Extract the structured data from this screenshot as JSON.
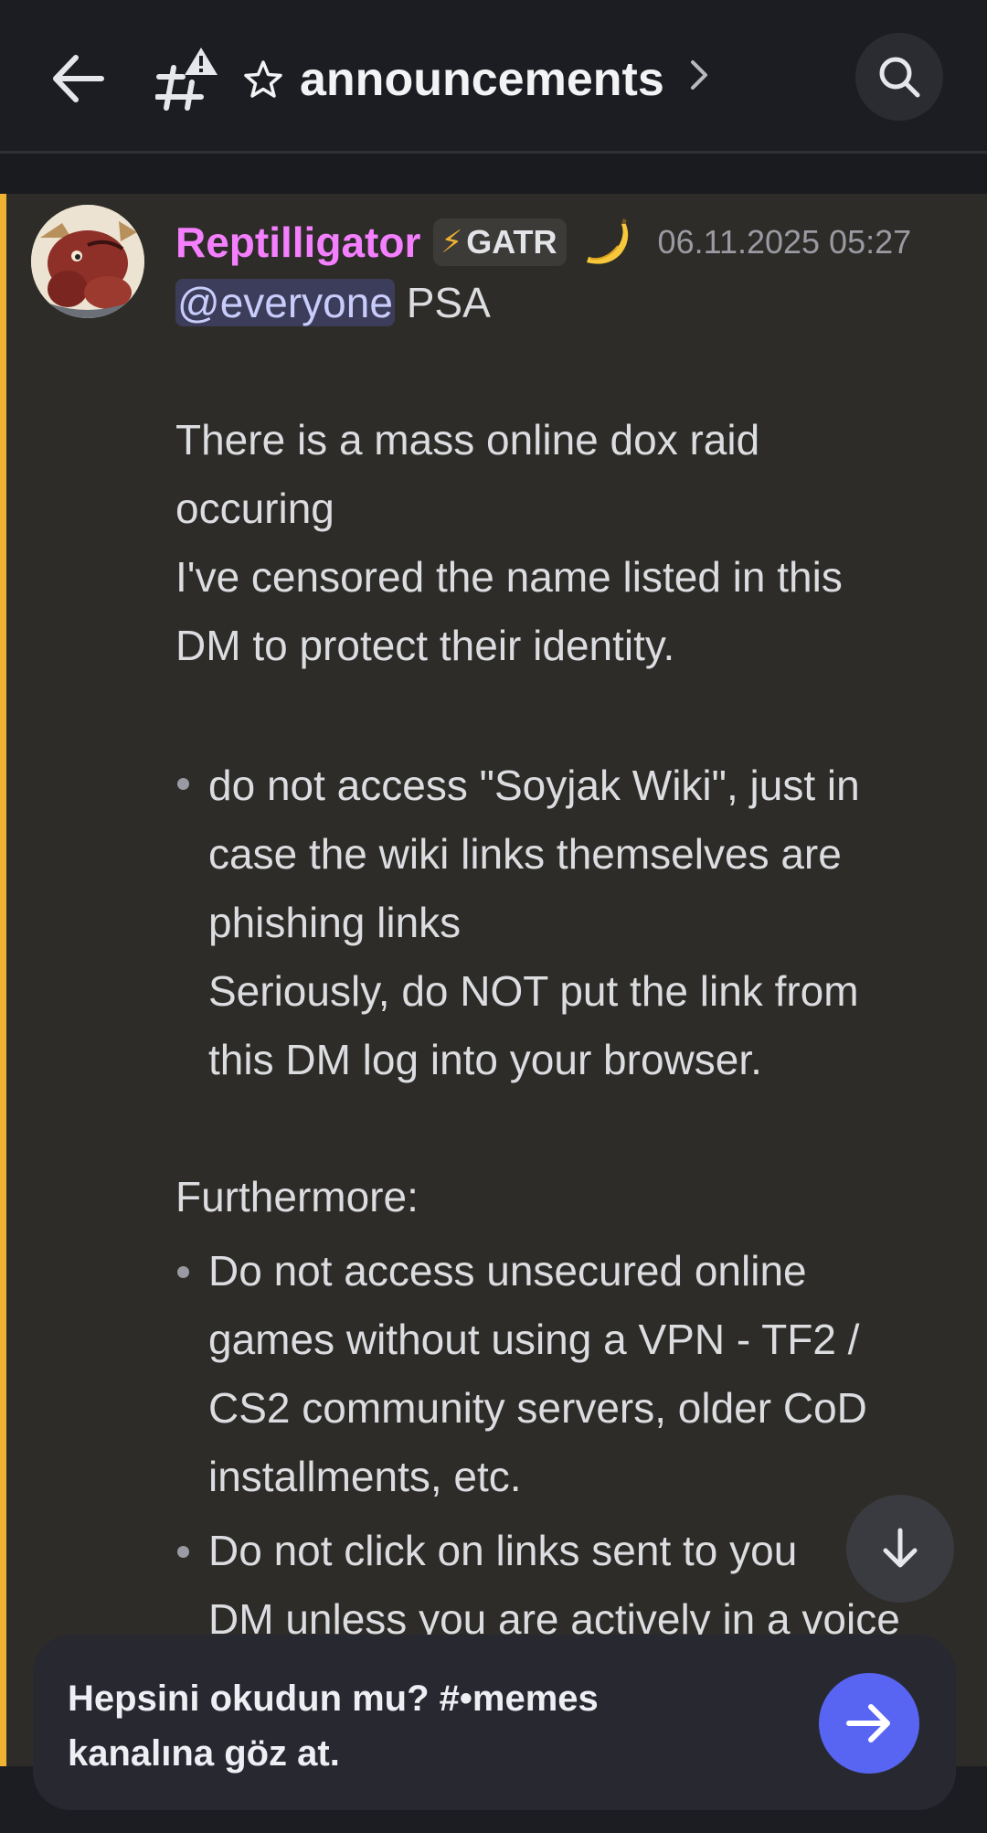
{
  "header": {
    "channel_name": "announcements",
    "channel_prefix_icon": "star-icon",
    "back_icon": "arrow-left-icon",
    "search_icon": "search-icon",
    "channel_type_icon": "announcement-channel-icon"
  },
  "message": {
    "author": "Reptilligator",
    "author_color": "#f47fff",
    "tag": "GATR",
    "tag_icon": "lightning-icon",
    "badge_icon": "banana-icon",
    "timestamp": "06.11.2025 05:27",
    "mention": "@everyone",
    "first_line_rest": " PSA",
    "para_1_line_1": "There is a mass online dox raid",
    "para_1_line_2": "occuring",
    "para_1_line_3": "I've censored the name listed in this",
    "para_1_line_4": "DM to protect their identity.",
    "bullet_1_line_1": "do not access \"Soyjak Wiki\", just in",
    "bullet_1_line_2": "case the wiki links themselves are",
    "bullet_1_line_3": "phishing links",
    "bullet_1_line_4": "Seriously, do NOT put the link from",
    "bullet_1_line_5": "this DM log into your browser.",
    "furthermore": "Furthermore:",
    "bullet_2_line_1": "Do not access unsecured online",
    "bullet_2_line_2": "games without using a VPN - TF2 /",
    "bullet_2_line_3": "CS2 community servers, older CoD",
    "bullet_2_line_4": "installments, etc.",
    "bullet_3_line_1": "Do not click on links sent to you",
    "bullet_3_line_2": "DM unless you are actively in a voice"
  },
  "banner": {
    "line_1": "Hepsini okudun mu? #•memes",
    "line_2": "kanalına göz at.",
    "go_icon": "arrow-right-icon",
    "accent": "#5865f2"
  },
  "scroll_down_icon": "arrow-down-icon",
  "colors": {
    "highlight": "#f0b232",
    "mention_bg": "#3c3d5a",
    "mention_text": "#c9cdfb"
  }
}
